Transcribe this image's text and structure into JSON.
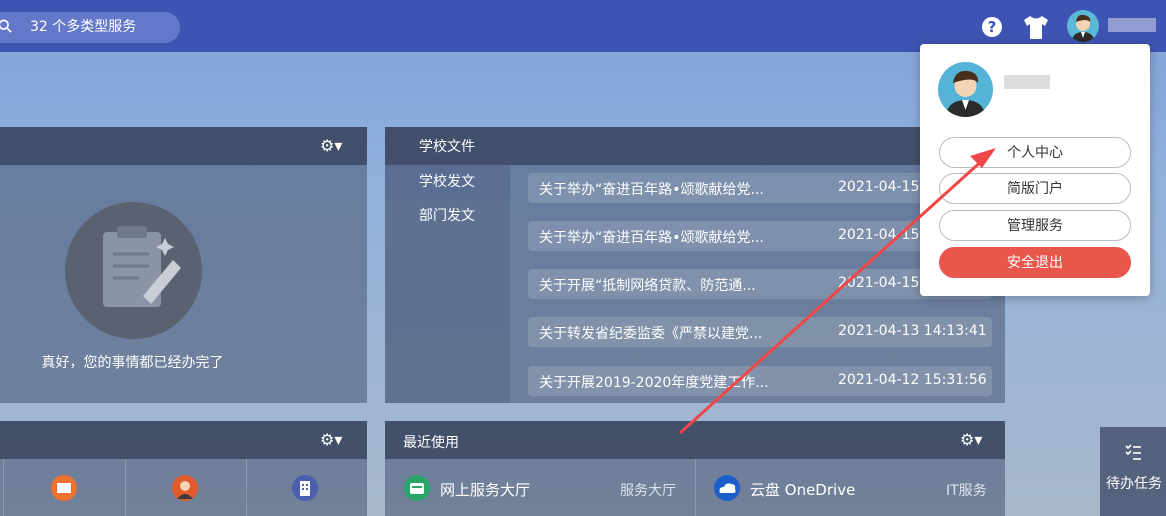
{
  "search": {
    "text": "32 个多类型服务"
  },
  "panel_todo": {
    "message": "真好，您的事情都已经办完了"
  },
  "school_docs": {
    "title": "学校文件",
    "tabs": [
      {
        "label": "学校发文"
      },
      {
        "label": "部门发文"
      }
    ],
    "items": [
      {
        "title": "关于举办“奋进百年路•颂歌献给党...",
        "date": "2021-04-15 1"
      },
      {
        "title": "关于举办“奋进百年路•颂歌献给党...",
        "date": "2021-04-15"
      },
      {
        "title": "关于开展“抵制网络贷款、防范通...",
        "date": "2021-04-15 0"
      },
      {
        "title": "关于转发省纪委监委《严禁以建党...",
        "date": "2021-04-13 14:13:41"
      },
      {
        "title": "关于开展2019-2020年度党建工作...",
        "date": "2021-04-12 15:31:56"
      }
    ]
  },
  "recent": {
    "title": "最近使用",
    "apps": [
      {
        "name": "网上服务大厅",
        "category": "服务大厅"
      },
      {
        "name": "云盘 OneDrive",
        "category": "IT服务"
      }
    ]
  },
  "todo_tab": {
    "label": "待办任务"
  },
  "user_menu": {
    "buttons": [
      {
        "label": "个人中心"
      },
      {
        "label": "简版门户"
      },
      {
        "label": "管理服务"
      },
      {
        "label": "安全退出"
      }
    ]
  },
  "colors": {
    "topbar": "#3e54b3",
    "logout": "#e8574c",
    "arrow": "#f04848"
  }
}
